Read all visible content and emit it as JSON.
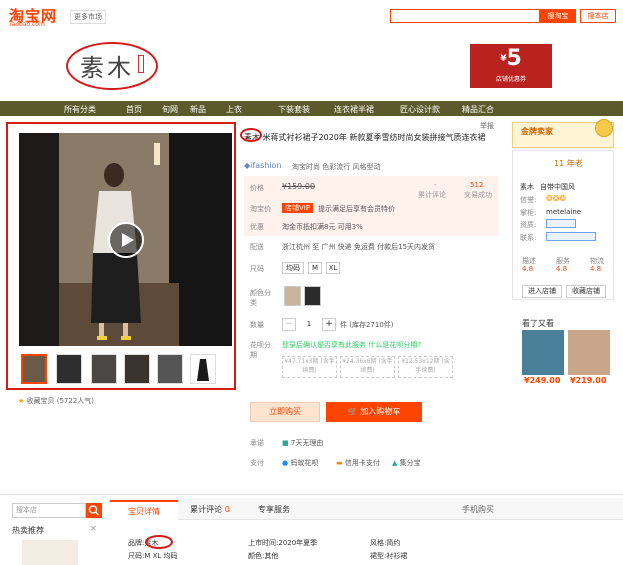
{
  "header": {
    "logo": "淘宝网",
    "logo_sub": "Taobao.com",
    "location": "更多市场",
    "search_button": "搜淘宝",
    "search_store_button": "搜本店"
  },
  "shop": {
    "brand": "素木",
    "coupon_amount": "5",
    "coupon_prefix": "¥",
    "coupon_desc": "店铺优惠券"
  },
  "nav": {
    "items": [
      "所有分类",
      "首页",
      "旬网",
      "新品",
      "上衣",
      "下装套装",
      "连衣裙半裙",
      "匠心设计款",
      "精品汇合"
    ]
  },
  "gallery": {
    "collect": "收藏宝贝 (5722人气)"
  },
  "product": {
    "title": "素木 米蒋式衬衫裙子2020年 新款夏季雪纺时尚女装拼接气质连衣裙",
    "title_right": "举报",
    "fashion_label": "ifashion",
    "fashion_desc": "淘宝时尚 色彩流行 风格型动",
    "price_label": "价格",
    "price": "¥159.00",
    "taobao_label": "淘宝价",
    "vip_badge": "店铺VIP",
    "vip_text": "提示满足后享有会员特价",
    "promo_label": "优惠",
    "promo_text": "淘金币抵扣满8元 可用3%",
    "review_count_label": "累计评论",
    "review_count": "-",
    "sales_label": "交易成功",
    "sales": "512",
    "ship_label": "配送",
    "ship_text": "浙江杭州 至 广州 快递 免运费 付款后15天内发货",
    "size_label": "尺码",
    "sizes": [
      "均码",
      "M",
      "XL"
    ],
    "color_label": "颜色分类",
    "qty_label": "数量",
    "qty_value": "1",
    "stock": "件 (库存2710件)",
    "installment_label": "花呗分期",
    "installment_text": "登录后确认是否享有此服务 什么是花呗分期?",
    "plans": [
      "¥47.71x3期 (含手续费)",
      "¥24.36x6期 (含手续费)",
      "¥12.53x12期 (含手续费)"
    ],
    "buy_now": "立即购买",
    "add_cart": "加入购物车",
    "service_label": "承诺",
    "service_text": "7天无理由",
    "pay_label": "支付",
    "pay_items": [
      "蚂蚁花呗",
      "信用卡支付",
      "集分宝"
    ]
  },
  "side": {
    "gold_title": "金牌卖家",
    "gold_rank": "11 年老",
    "shop_name": "素木",
    "shop_desc": "自带中国风",
    "account_label": "掌柜:",
    "account": "metelaine",
    "qual_label": "资质:",
    "contact_label": "联系:",
    "ratings": [
      {
        "label": "描述",
        "value": "4.8"
      },
      {
        "label": "服务",
        "value": "4.8"
      },
      {
        "label": "物流",
        "value": "4.8"
      }
    ],
    "enter_shop": "进入店铺",
    "fav_shop": "收藏店铺",
    "viewed_title": "看了又看",
    "rec_prices": [
      "¥249.00",
      "¥219.00"
    ]
  },
  "bottom": {
    "shop_search_placeholder": "搜本店",
    "hot_label": "热卖推荐",
    "tabs": [
      "宝贝详情",
      "累计评论",
      "专享服务"
    ],
    "tab_counts": [
      "",
      "0",
      ""
    ],
    "qr_label": "手机购买",
    "detail_brand_label": "品牌:",
    "detail_brand": "素木",
    "detail_size_label": "尺码:",
    "detail_size": "M XL 均码",
    "detail_date_label": "上市时间:",
    "detail_date": "2020年夏季",
    "detail_color_label": "颜色:",
    "detail_color": "其他",
    "detail_style_label": "风格:",
    "detail_style": "简约",
    "detail_type_label": "裙型:",
    "detail_type": "衬衫裙"
  }
}
